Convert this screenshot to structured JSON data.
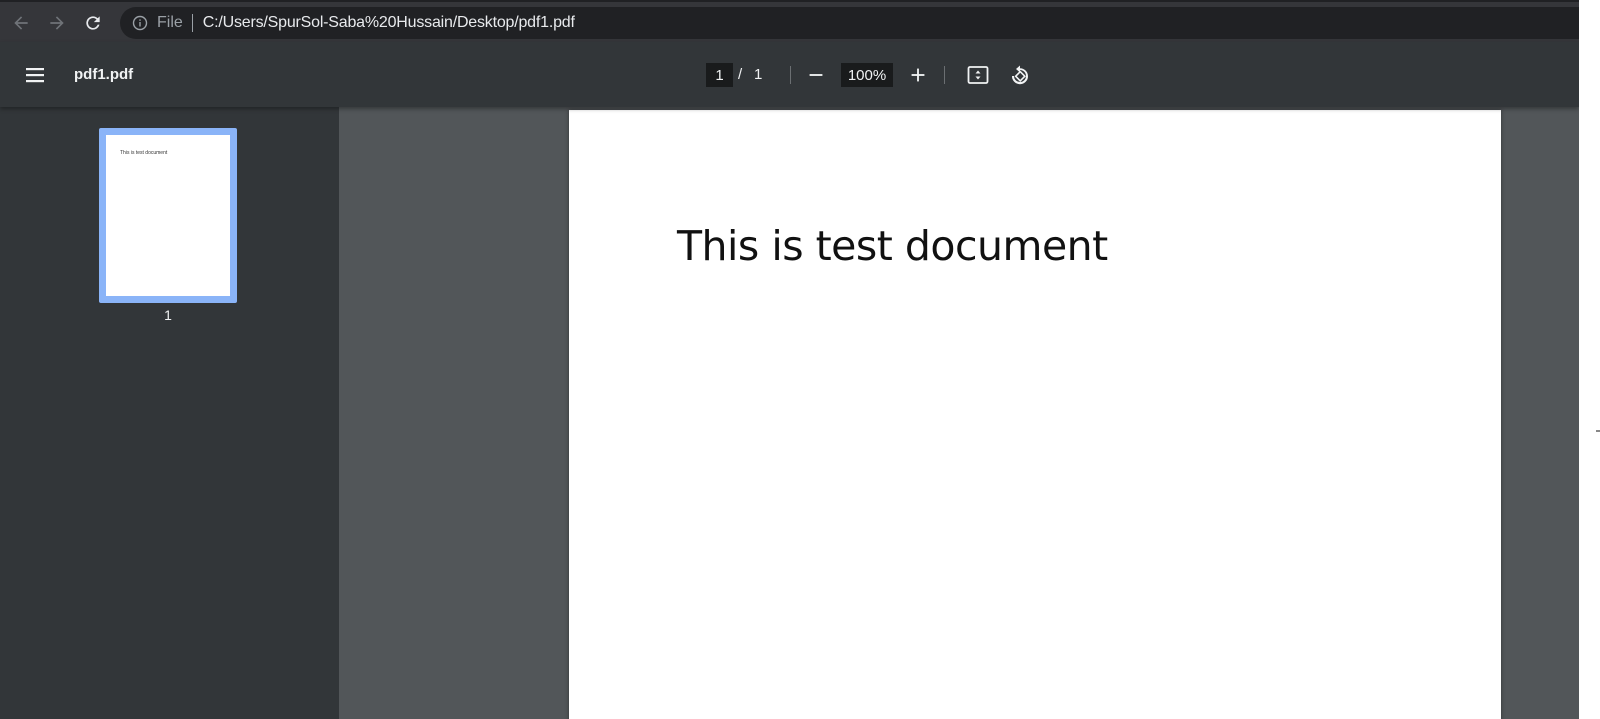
{
  "browser": {
    "address_scheme": "File",
    "address_url": "C:/Users/SpurSol-Saba%20Hussain/Desktop/pdf1.pdf",
    "icons": {
      "back": "arrow-left-icon",
      "forward": "arrow-right-icon",
      "reload": "reload-icon",
      "site_info": "info-icon"
    }
  },
  "toolbar": {
    "title": "pdf1.pdf",
    "current_page": "1",
    "page_separator": "/",
    "total_pages": "1",
    "zoom": "100%",
    "icons": {
      "menu": "hamburger-menu-icon",
      "zoom_out": "minus-icon",
      "zoom_in": "plus-icon",
      "fit": "fit-to-page-icon",
      "rotate": "rotate-counterclockwise-icon"
    }
  },
  "sidebar": {
    "thumbnails": [
      {
        "label": "1",
        "preview_text": "This is test document",
        "selected": true
      }
    ],
    "selected_color": "#8ab4f8"
  },
  "document": {
    "text": "This is test document"
  }
}
